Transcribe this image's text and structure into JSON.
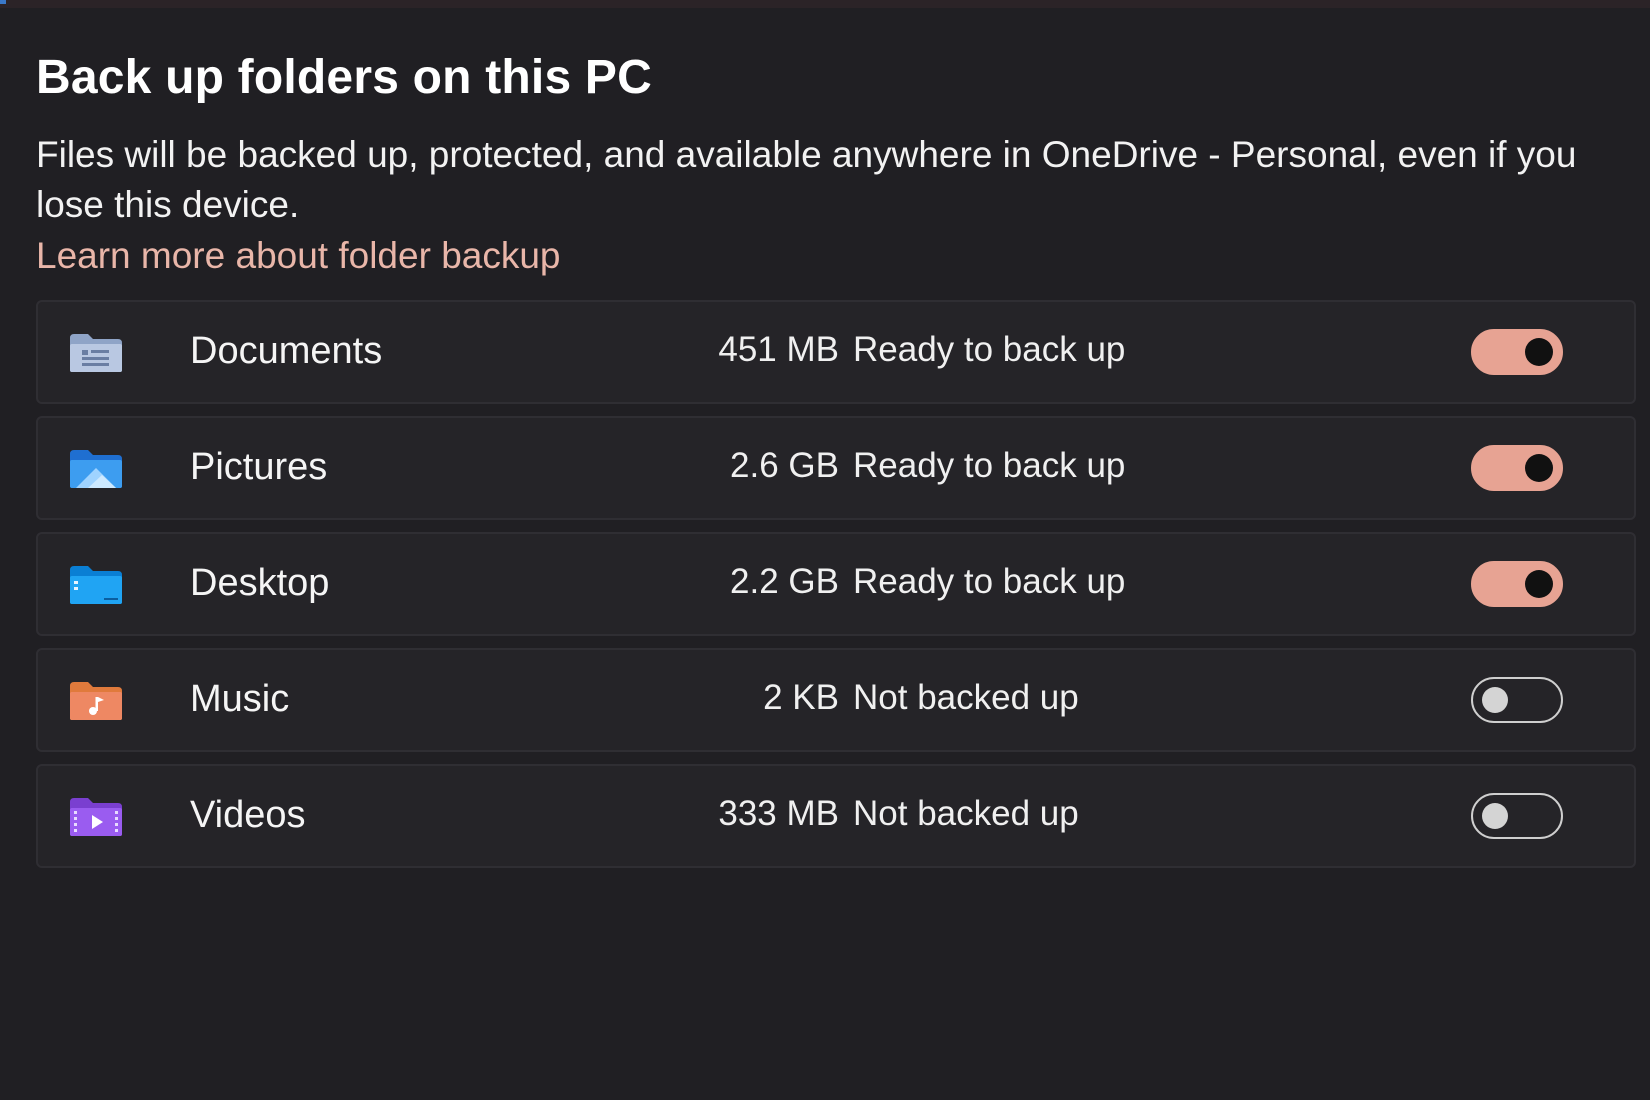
{
  "title": "Back up folders on this PC",
  "description": "Files will be backed up, protected, and available anywhere in OneDrive - Personal, even if you lose this device.",
  "learn_more_link": "Learn more about folder backup",
  "colors": {
    "background": "#201f23",
    "accent_toggle_on": "#e7a393",
    "link": "#e9b6a9"
  },
  "folders": [
    {
      "name": "Documents",
      "size": "451 MB",
      "status": "Ready to back up",
      "backup_enabled": true,
      "icon": "documents-folder-icon"
    },
    {
      "name": "Pictures",
      "size": "2.6 GB",
      "status": "Ready to back up",
      "backup_enabled": true,
      "icon": "pictures-folder-icon"
    },
    {
      "name": "Desktop",
      "size": "2.2 GB",
      "status": "Ready to back up",
      "backup_enabled": true,
      "icon": "desktop-folder-icon"
    },
    {
      "name": "Music",
      "size": "2 KB",
      "status": "Not backed up",
      "backup_enabled": false,
      "icon": "music-folder-icon"
    },
    {
      "name": "Videos",
      "size": "333 MB",
      "status": "Not backed up",
      "backup_enabled": false,
      "icon": "videos-folder-icon"
    }
  ]
}
